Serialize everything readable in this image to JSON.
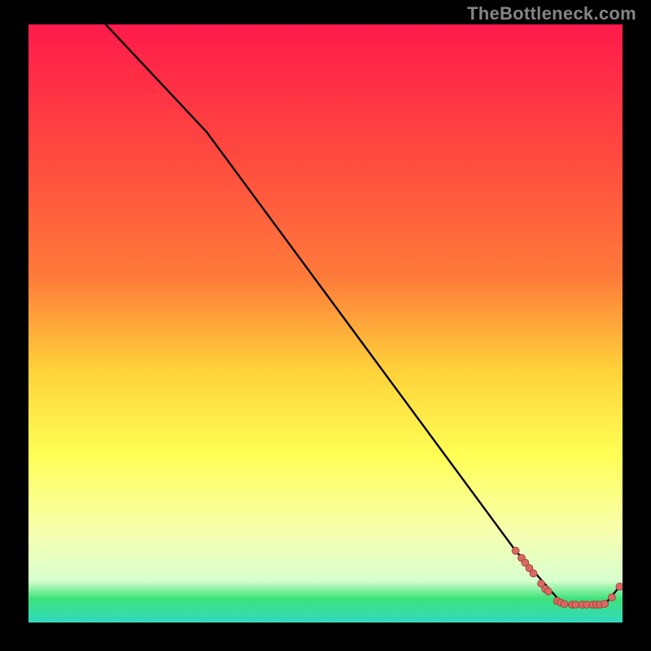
{
  "watermark": "TheBottleneck.com",
  "colors": {
    "bg_black": "#000000",
    "grad_top": "#ff1a4b",
    "grad_mid1": "#ff7a3a",
    "grad_mid2": "#ffd23a",
    "grad_mid3": "#ffff55",
    "grad_low": "#f7ffb0",
    "grad_green": "#3de27a",
    "grad_cyan": "#32d9c0",
    "line": "#000000",
    "dot_fill": "#d96a62",
    "dot_stroke": "#a0463f"
  },
  "chart_data": {
    "type": "line",
    "title": "",
    "xlabel": "",
    "ylabel": "",
    "xlim": [
      0,
      100
    ],
    "ylim": [
      0,
      100
    ],
    "series": [
      {
        "name": "bottleneck-curve",
        "x": [
          13,
          30,
          82,
          90,
          97,
          99.5
        ],
        "y": [
          100,
          82,
          12,
          3,
          3,
          6
        ]
      }
    ],
    "points": {
      "name": "sample-points",
      "x": [
        82,
        83,
        83.6,
        84.3,
        85,
        86.3,
        87,
        87.5,
        89,
        89.6,
        90.2,
        91.5,
        92.1,
        93.2,
        94,
        95,
        95.6,
        96.2,
        97,
        98.2,
        99.5
      ],
      "y": [
        12,
        10.8,
        10,
        9.1,
        8.2,
        6.5,
        5.6,
        5.2,
        3.6,
        3.3,
        3.1,
        3,
        3,
        3,
        3,
        3,
        3,
        3,
        3.1,
        4.2,
        6
      ]
    }
  }
}
